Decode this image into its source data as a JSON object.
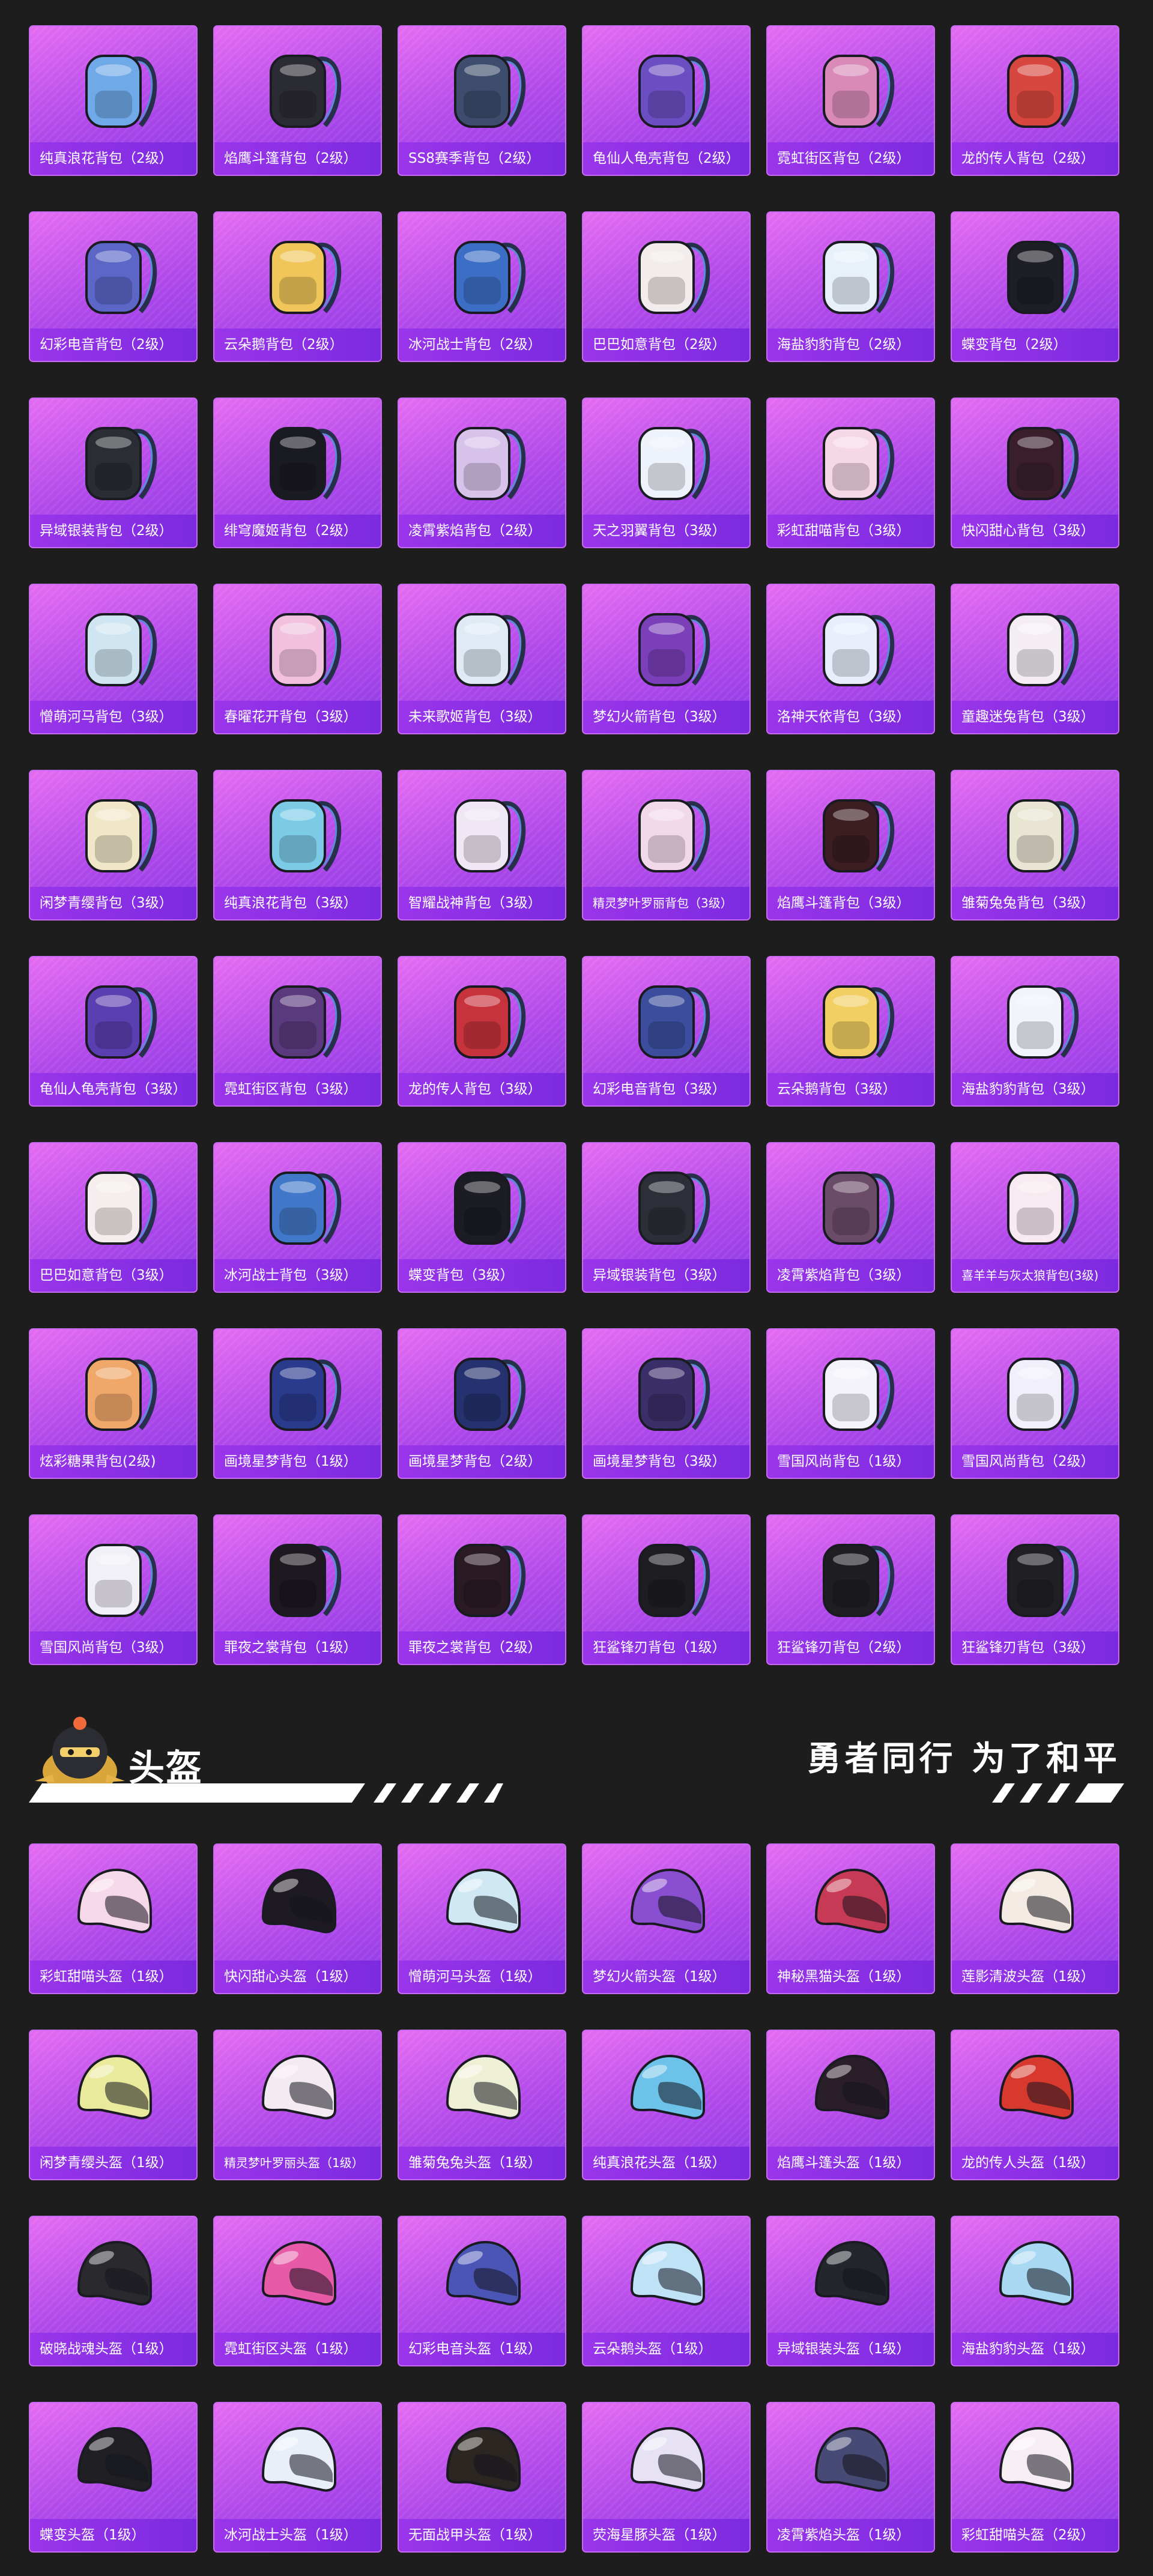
{
  "backpacks": [
    {
      "label": "纯真浪花背包（2级）",
      "icon": "backpack-icon",
      "color": "#6fa9e8"
    },
    {
      "label": "焰鹰斗篷背包（2级）",
      "icon": "backpack-icon",
      "color": "#2b2b33"
    },
    {
      "label": "SS8赛季背包（2级）",
      "icon": "backpack-icon",
      "color": "#3e4d6e"
    },
    {
      "label": "龟仙人龟壳背包（2级）",
      "icon": "backpack-icon",
      "color": "#6b4fc2"
    },
    {
      "label": "霓虹街区背包（2级）",
      "icon": "backpack-icon",
      "color": "#d98ab8"
    },
    {
      "label": "龙的传人背包（2级）",
      "icon": "backpack-icon",
      "color": "#d8473f"
    },
    {
      "label": "幻彩电音背包（2级）",
      "icon": "backpack-icon",
      "color": "#5b66c7"
    },
    {
      "label": "云朵鹅背包（2级）",
      "icon": "backpack-icon",
      "color": "#f0c65a"
    },
    {
      "label": "冰河战士背包（2级）",
      "icon": "backpack-icon",
      "color": "#3d6ec6"
    },
    {
      "label": "巴巴如意背包（2级）",
      "icon": "backpack-icon",
      "color": "#f3ecec"
    },
    {
      "label": "海盐豹豹背包（2级）",
      "icon": "backpack-icon",
      "color": "#e8f1fa"
    },
    {
      "label": "蝶变背包（2级）",
      "icon": "backpack-icon",
      "color": "#1e1e26"
    },
    {
      "label": "异域银装背包（2级）",
      "icon": "backpack-icon",
      "color": "#2a2d34"
    },
    {
      "label": "绯穹魔姬背包（2级）",
      "icon": "backpack-icon",
      "color": "#1a1a22"
    },
    {
      "label": "凌霄紫焰背包（2级）",
      "icon": "backpack-icon",
      "color": "#d7c2ea"
    },
    {
      "label": "天之羽翼背包（3级）",
      "icon": "backpack-icon",
      "color": "#eef2fb"
    },
    {
      "label": "彩虹甜喵背包（3级）",
      "icon": "backpack-icon",
      "color": "#f6d7e6"
    },
    {
      "label": "快闪甜心背包（3级）",
      "icon": "backpack-icon",
      "color": "#3a1f2a"
    },
    {
      "label": "憎萌河马背包（3级）",
      "icon": "backpack-icon",
      "color": "#cfe6f2"
    },
    {
      "label": "春曜花开背包（3级）",
      "icon": "backpack-icon",
      "color": "#f2c1de"
    },
    {
      "label": "未来歌姬背包（3级）",
      "icon": "backpack-icon",
      "color": "#dfeaf4"
    },
    {
      "label": "梦幻火箭背包（3级）",
      "icon": "backpack-icon",
      "color": "#7b3fb9"
    },
    {
      "label": "洛神天依背包（3级）",
      "icon": "backpack-icon",
      "color": "#e9eefc"
    },
    {
      "label": "童趣迷兔背包（3级）",
      "icon": "backpack-icon",
      "color": "#f4eef3"
    },
    {
      "label": "闲梦青缨背包（3级）",
      "icon": "backpack-icon",
      "color": "#f0e7c8"
    },
    {
      "label": "纯真浪花背包（3级）",
      "icon": "backpack-icon",
      "color": "#7ccbe6"
    },
    {
      "label": "智耀战神背包（3级）",
      "icon": "backpack-icon",
      "color": "#efe7f3"
    },
    {
      "label": "精灵梦叶罗丽背包（3级）",
      "icon": "backpack-icon",
      "color": "#f2d9ea"
    },
    {
      "label": "焰鹰斗篷背包（3级）",
      "icon": "backpack-icon",
      "color": "#3b1d22"
    },
    {
      "label": "雏菊兔兔背包（3级）",
      "icon": "backpack-icon",
      "color": "#e8e5d2"
    },
    {
      "label": "龟仙人龟壳背包（3级）",
      "icon": "backpack-icon",
      "color": "#5a3fb0"
    },
    {
      "label": "霓虹街区背包（3级）",
      "icon": "backpack-icon",
      "color": "#5a3a7c"
    },
    {
      "label": "龙的传人背包（3级）",
      "icon": "backpack-icon",
      "color": "#c7333c"
    },
    {
      "label": "幻彩电音背包（3级）",
      "icon": "backpack-icon",
      "color": "#3b4d9c"
    },
    {
      "label": "云朵鹅背包（3级）",
      "icon": "backpack-icon",
      "color": "#f1cf63"
    },
    {
      "label": "海盐豹豹背包（3级）",
      "icon": "backpack-icon",
      "color": "#f2f3fb"
    },
    {
      "label": "巴巴如意背包（3级）",
      "icon": "backpack-icon",
      "color": "#f6eeee"
    },
    {
      "label": "冰河战士背包（3级）",
      "icon": "backpack-icon",
      "color": "#4278c9"
    },
    {
      "label": "蝶变背包（3级）",
      "icon": "backpack-icon",
      "color": "#1c1c24"
    },
    {
      "label": "异域银装背包（3级）",
      "icon": "backpack-icon",
      "color": "#2c2f38"
    },
    {
      "label": "凌霄紫焰背包（3级）",
      "icon": "backpack-icon",
      "color": "#6b4c68"
    },
    {
      "label": "喜羊羊与灰太狼背包(3级)",
      "icon": "backpack-icon",
      "color": "#f7eaf0"
    },
    {
      "label": "炫彩糖果背包(2级)",
      "icon": "backpack-icon",
      "color": "#f0a86a"
    },
    {
      "label": "画境星梦背包（1级）",
      "icon": "backpack-icon",
      "color": "#2a3a8c"
    },
    {
      "label": "画境星梦背包（2级）",
      "icon": "backpack-icon",
      "color": "#25326f"
    },
    {
      "label": "画境星梦背包（3级）",
      "icon": "backpack-icon",
      "color": "#3b2f6a"
    },
    {
      "label": "雪国风尚背包（1级）",
      "icon": "backpack-icon",
      "color": "#f4f3fb"
    },
    {
      "label": "雪国风尚背包（2级）",
      "icon": "backpack-icon",
      "color": "#f1f0fa"
    },
    {
      "label": "雪国风尚背包（3级）",
      "icon": "backpack-icon",
      "color": "#f2f0f7"
    },
    {
      "label": "罪夜之裳背包（1级）",
      "icon": "backpack-icon",
      "color": "#1e1820"
    },
    {
      "label": "罪夜之裳背包（2级）",
      "icon": "backpack-icon",
      "color": "#2a1a24"
    },
    {
      "label": "狂鲨锋刃背包（1级）",
      "icon": "backpack-icon",
      "color": "#1e1e22"
    },
    {
      "label": "狂鲨锋刃背包（2级）",
      "icon": "backpack-icon",
      "color": "#1f1f23"
    },
    {
      "label": "狂鲨锋刃背包（3级）",
      "icon": "backpack-icon",
      "color": "#202024"
    }
  ],
  "section": {
    "title": "头盔",
    "slogan": "勇者同行 为了和平",
    "mascot_icon": "chicken-knight-icon"
  },
  "helmets": [
    {
      "label": "彩虹甜喵头盔（1级）",
      "icon": "helmet-icon",
      "color": "#f6d9e8"
    },
    {
      "label": "快闪甜心头盔（1级）",
      "icon": "helmet-icon",
      "color": "#1e1a22"
    },
    {
      "label": "憎萌河马头盔（1级）",
      "icon": "helmet-icon",
      "color": "#cfe8f3"
    },
    {
      "label": "梦幻火箭头盔（1级）",
      "icon": "helmet-icon",
      "color": "#8a4fd0"
    },
    {
      "label": "神秘黑猫头盔（1级）",
      "icon": "helmet-icon",
      "color": "#c73a55"
    },
    {
      "label": "莲影清波头盔（1级）",
      "icon": "helmet-icon",
      "color": "#f3ebe3"
    },
    {
      "label": "闲梦青缨头盔（1级）",
      "icon": "helmet-icon",
      "color": "#e9ea9c"
    },
    {
      "label": "精灵梦叶罗丽头盔（1级）",
      "icon": "helmet-icon",
      "color": "#f4eaf1"
    },
    {
      "label": "雏菊兔兔头盔（1级）",
      "icon": "helmet-icon",
      "color": "#eef0d6"
    },
    {
      "label": "纯真浪花头盔（1级）",
      "icon": "helmet-icon",
      "color": "#6cc2e8"
    },
    {
      "label": "焰鹰斗篷头盔（1级）",
      "icon": "helmet-icon",
      "color": "#2a1e28"
    },
    {
      "label": "龙的传人头盔（1级）",
      "icon": "helmet-icon",
      "color": "#d8392f"
    },
    {
      "label": "破晓战魂头盔（1级）",
      "icon": "helmet-icon",
      "color": "#2a2a2e"
    },
    {
      "label": "霓虹街区头盔（1级）",
      "icon": "helmet-icon",
      "color": "#e65aa7"
    },
    {
      "label": "幻彩电音头盔（1级）",
      "icon": "helmet-icon",
      "color": "#4b55b6"
    },
    {
      "label": "云朵鹅头盔（1级）",
      "icon": "helmet-icon",
      "color": "#bfe2f7"
    },
    {
      "label": "异域银装头盔（1级）",
      "icon": "helmet-icon",
      "color": "#23262c"
    },
    {
      "label": "海盐豹豹头盔（1级）",
      "icon": "helmet-icon",
      "color": "#a9d8f2"
    },
    {
      "label": "蝶变头盔（1级）",
      "icon": "helmet-icon",
      "color": "#1f1f24"
    },
    {
      "label": "冰河战士头盔（1级）",
      "icon": "helmet-icon",
      "color": "#e9eff8"
    },
    {
      "label": "无面战甲头盔（1级）",
      "icon": "helmet-icon",
      "color": "#2b2622"
    },
    {
      "label": "荧海星豚头盔（1级）",
      "icon": "helmet-icon",
      "color": "#e6e2f3"
    },
    {
      "label": "凌霄紫焰头盔（1级）",
      "icon": "helmet-icon",
      "color": "#474a74"
    },
    {
      "label": "彩虹甜喵头盔（2级）",
      "icon": "helmet-icon",
      "color": "#f7eef4"
    }
  ]
}
